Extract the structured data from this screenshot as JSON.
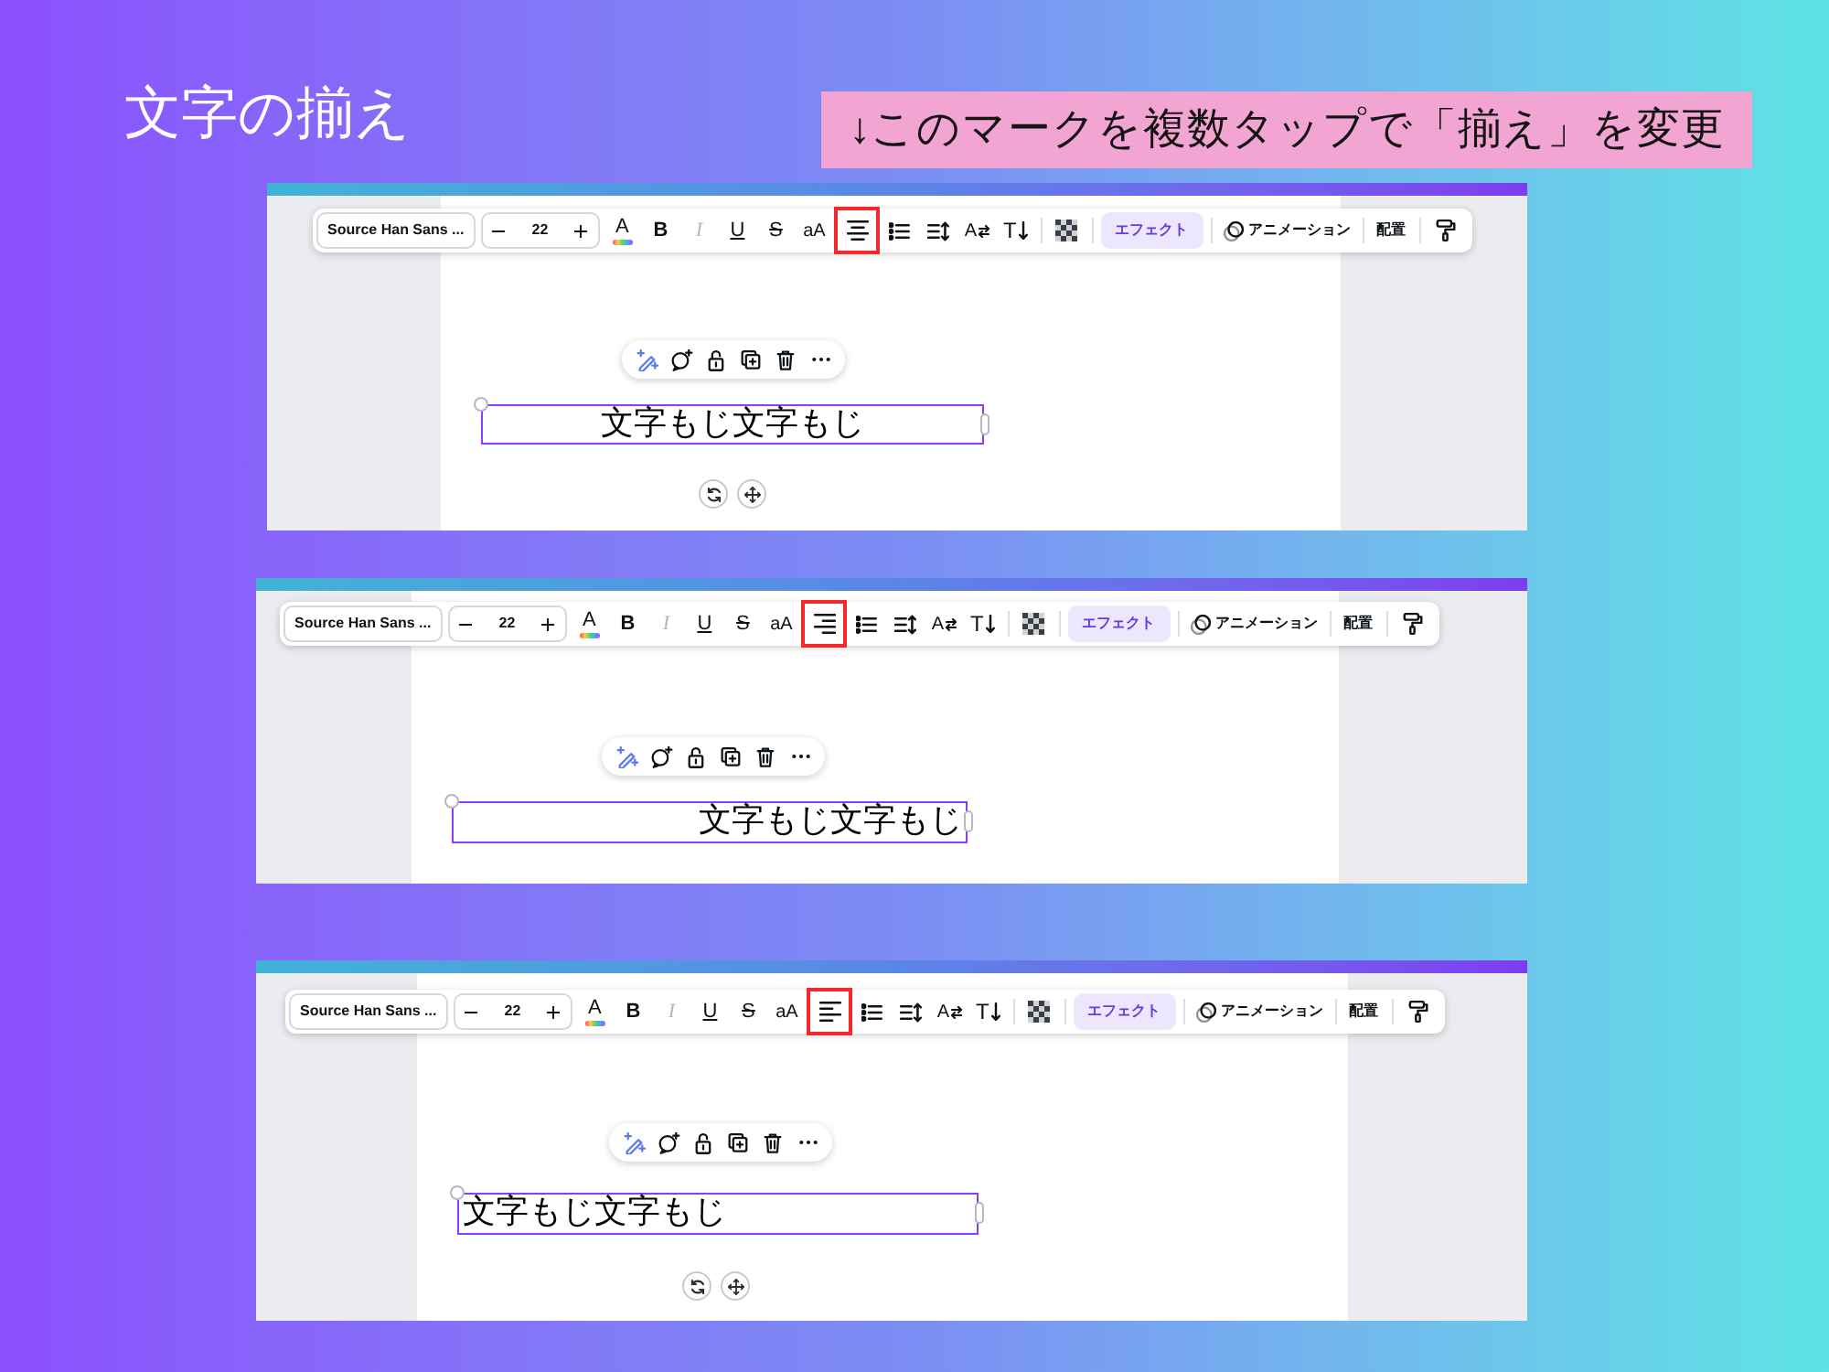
{
  "title": "文字の揃え",
  "callout": "↓このマークを複数タップで「揃え」を変更",
  "panels": [
    {
      "toolbar": {
        "font": "Source Han Sans ...",
        "size": "22",
        "color_letter": "A",
        "bold": "B",
        "italic": "I",
        "italic_disabled": true,
        "underline": "U",
        "strikethrough": "S",
        "case": "aA",
        "align_button": {
          "kind": "center",
          "marked": true
        },
        "spacing_letter": "A",
        "direction_letter": "T",
        "effects": "エフェクト",
        "animation": "アニメーション",
        "position": "配置"
      },
      "text_box": {
        "kind": "center",
        "text": "文字もじ文字もじ"
      },
      "canvas_handles": true
    },
    {
      "toolbar": {
        "font": "Source Han Sans ...",
        "size": "22",
        "color_letter": "A",
        "bold": "B",
        "italic": "I",
        "italic_disabled": true,
        "underline": "U",
        "strikethrough": "S",
        "case": "aA",
        "align_button": {
          "kind": "right",
          "marked": true
        },
        "spacing_letter": "A",
        "direction_letter": "T",
        "effects": "エフェクト",
        "animation": "アニメーション",
        "position": "配置"
      },
      "text_box": {
        "kind": "right",
        "text": "文字もじ文字もじ"
      },
      "canvas_handles": false
    },
    {
      "toolbar": {
        "font": "Source Han Sans ...",
        "size": "22",
        "color_letter": "A",
        "bold": "B",
        "italic": "I",
        "italic_disabled": true,
        "underline": "U",
        "strikethrough": "S",
        "case": "aA",
        "align_button": {
          "kind": "left",
          "marked": true
        },
        "spacing_letter": "A",
        "direction_letter": "T",
        "effects": "エフェクト",
        "animation": "アニメーション",
        "position": "配置"
      },
      "text_box": {
        "kind": "left",
        "text": "文字もじ文字もじ"
      },
      "canvas_handles": true
    }
  ]
}
